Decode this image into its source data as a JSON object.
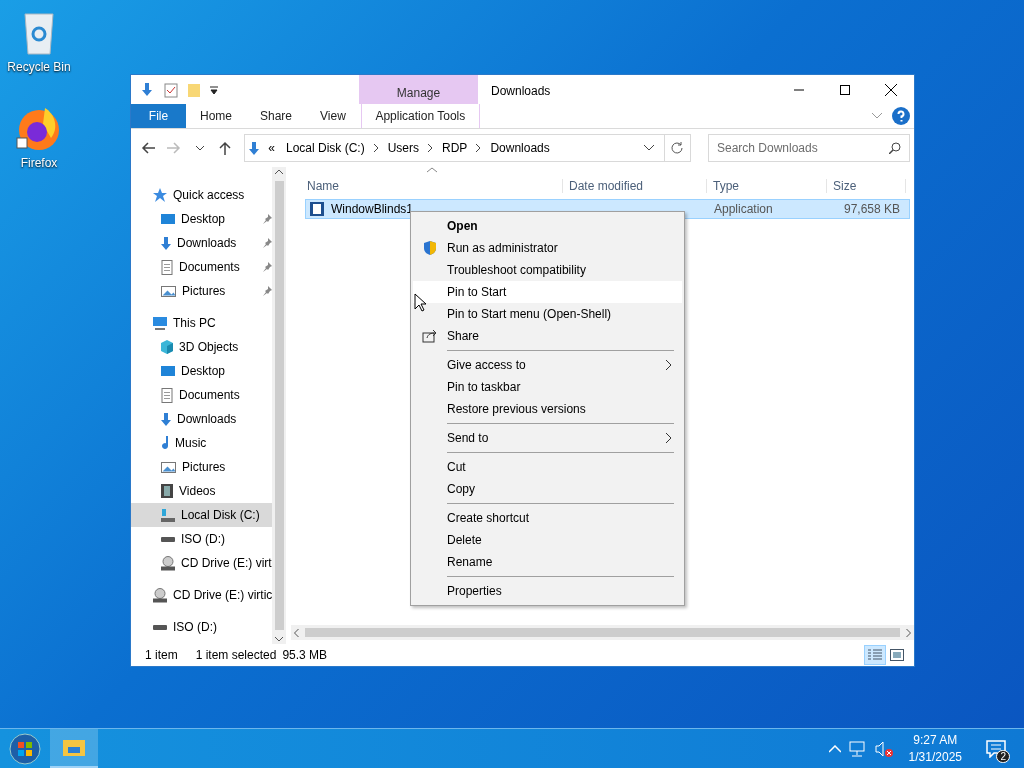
{
  "desktop_icons": [
    {
      "kind": "recycle",
      "label": "Recycle Bin"
    },
    {
      "kind": "firefox",
      "label": "Firefox"
    }
  ],
  "window": {
    "title": "Downloads",
    "contextual_tab": "Manage",
    "ribbon_tabs": [
      {
        "label": "File",
        "kind": "file",
        "selected": false
      },
      {
        "label": "Home",
        "kind": "tab",
        "selected": false
      },
      {
        "label": "Share",
        "kind": "tab",
        "selected": false
      },
      {
        "label": "View",
        "kind": "tab",
        "selected": false
      },
      {
        "label": "Application Tools",
        "kind": "contextual",
        "selected": false
      }
    ],
    "address": {
      "overflow": "«",
      "crumbs": [
        "Local Disk (C:)",
        "Users",
        "RDP",
        "Downloads"
      ]
    },
    "search": {
      "placeholder": "Search Downloads"
    },
    "nav": [
      {
        "label": "Quick access",
        "kind": "star",
        "selected": false,
        "children": [
          {
            "label": "Desktop",
            "kind": "desktop",
            "pinned": true,
            "selected": false
          },
          {
            "label": "Downloads",
            "kind": "download",
            "pinned": true,
            "selected": false
          },
          {
            "label": "Documents",
            "kind": "document",
            "pinned": true,
            "selected": false
          },
          {
            "label": "Pictures",
            "kind": "picture",
            "pinned": true,
            "selected": false
          }
        ]
      },
      {
        "label": "This PC",
        "kind": "pc",
        "selected": false,
        "children": [
          {
            "label": "3D Objects",
            "kind": "cube",
            "pinned": false,
            "selected": false
          },
          {
            "label": "Desktop",
            "kind": "desktop",
            "pinned": false,
            "selected": false
          },
          {
            "label": "Documents",
            "kind": "document",
            "pinned": false,
            "selected": false
          },
          {
            "label": "Downloads",
            "kind": "download",
            "pinned": false,
            "selected": false
          },
          {
            "label": "Music",
            "kind": "music",
            "pinned": false,
            "selected": false
          },
          {
            "label": "Pictures",
            "kind": "picture",
            "pinned": false,
            "selected": false
          },
          {
            "label": "Videos",
            "kind": "video",
            "pinned": false,
            "selected": false
          },
          {
            "label": "Local Disk (C:)",
            "kind": "disk",
            "pinned": false,
            "selected": true
          },
          {
            "label": "ISO (D:)",
            "kind": "drive",
            "pinned": false,
            "selected": false
          },
          {
            "label": "CD Drive (E:) virt",
            "kind": "cd",
            "pinned": false,
            "selected": false
          }
        ]
      },
      {
        "label": "CD Drive (E:) virtic",
        "kind": "cd",
        "selected": false
      },
      {
        "label": "ISO (D:)",
        "kind": "drive",
        "selected": false
      }
    ],
    "columns": [
      "Name",
      "Date modified",
      "Type",
      "Size"
    ],
    "files": [
      {
        "name": "WindowBlinds1",
        "type": "Application",
        "size": "97,658 KB",
        "selected": true
      }
    ],
    "status": {
      "count": "1 item",
      "selection": "1 item selected",
      "size": "95.3 MB"
    },
    "context_menu": [
      [
        {
          "label": "Open",
          "kind": "default",
          "selected": false
        },
        {
          "label": "Run as administrator",
          "kind": "shield",
          "selected": false
        },
        {
          "label": "Troubleshoot compatibility",
          "kind": "item",
          "selected": false
        },
        {
          "label": "Pin to Start",
          "kind": "item",
          "selected": true
        },
        {
          "label": "Pin to Start menu (Open-Shell)",
          "kind": "item",
          "selected": false
        },
        {
          "label": "Share",
          "kind": "share",
          "selected": false
        }
      ],
      [
        {
          "label": "Give access to",
          "kind": "submenu",
          "selected": false
        },
        {
          "label": "Pin to taskbar",
          "kind": "item",
          "selected": false
        },
        {
          "label": "Restore previous versions",
          "kind": "item",
          "selected": false
        }
      ],
      [
        {
          "label": "Send to",
          "kind": "submenu",
          "selected": false
        }
      ],
      [
        {
          "label": "Cut",
          "kind": "item",
          "selected": false
        },
        {
          "label": "Copy",
          "kind": "item",
          "selected": false
        }
      ],
      [
        {
          "label": "Create shortcut",
          "kind": "item",
          "selected": false
        },
        {
          "label": "Delete",
          "kind": "item",
          "selected": false
        },
        {
          "label": "Rename",
          "kind": "item",
          "selected": false
        }
      ],
      [
        {
          "label": "Properties",
          "kind": "item",
          "selected": false
        }
      ]
    ]
  },
  "taskbar": {
    "time": "9:27 AM",
    "date": "1/31/2025",
    "notifications": "2"
  }
}
